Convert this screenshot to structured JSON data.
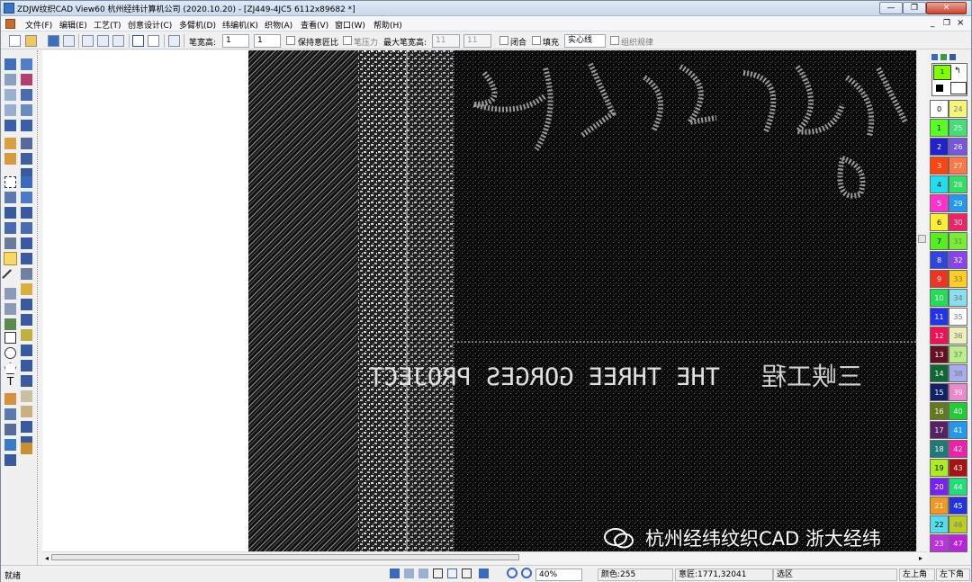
{
  "window": {
    "title": "ZDJW纹织CAD View60 杭州经纬计算机公司 (2020.10.20) - [ZJ449-4JC5 6112x89682 *]",
    "min_label": "—",
    "max_label": "❐",
    "close_label": "✕"
  },
  "menu": {
    "items": [
      "文件(F)",
      "编辑(E)",
      "工艺(T)",
      "创意设计(C)",
      "多臂机(D)",
      "纬编机(K)",
      "织物(A)",
      "查看(V)",
      "窗口(W)",
      "帮助(H)"
    ],
    "mdi_min": "_",
    "mdi_restore": "❐",
    "mdi_close": "×"
  },
  "toolbar": {
    "pen_height_label": "笔宽高:",
    "pen_w_value": "1",
    "pen_h_value": "1",
    "keep_ratio_label": "保持意匠比",
    "pen_pressure_label": "笔压力",
    "max_pen_label": "最大笔宽高:",
    "max_w_value": "11",
    "max_h_value": "11",
    "closed_label": "闭合",
    "fill_label": "填充",
    "line_type_value": "实心线",
    "tissue_rule_label": "组织规律"
  },
  "pattern": {
    "reversed_text": "THE THREE GORGES PROJECT",
    "cjk_fragment": "三峡工程"
  },
  "palette": {
    "current_color": "#7fff00",
    "background_color": "#ffffff",
    "swatches": [
      {
        "left": "0",
        "right": "24",
        "lc": "#ffffff",
        "rc": "#f5f57a"
      },
      {
        "left": "1",
        "right": "25",
        "lc": "#55ff22",
        "rc": "#44dd77"
      },
      {
        "left": "2",
        "right": "26",
        "lc": "#2222cc",
        "rc": "#7755dd"
      },
      {
        "left": "3",
        "right": "27",
        "lc": "#ff4411",
        "rc": "#ff7744"
      },
      {
        "left": "4",
        "right": "28",
        "lc": "#22ddee",
        "rc": "#33dd66"
      },
      {
        "left": "5",
        "right": "29",
        "lc": "#ff33cc",
        "rc": "#2299ee"
      },
      {
        "left": "6",
        "right": "30",
        "lc": "#ffee33",
        "rc": "#ee2266"
      },
      {
        "left": "7",
        "right": "31",
        "lc": "#55ee22",
        "rc": "#77ee33"
      },
      {
        "left": "8",
        "right": "32",
        "lc": "#3344dd",
        "rc": "#8844ee"
      },
      {
        "left": "9",
        "right": "33",
        "lc": "#ee3322",
        "rc": "#ffcc22"
      },
      {
        "left": "10",
        "right": "34",
        "lc": "#22dd55",
        "rc": "#88ddee"
      },
      {
        "left": "11",
        "right": "35",
        "lc": "#2233ee",
        "rc": "#ffffff"
      },
      {
        "left": "12",
        "right": "36",
        "lc": "#ee1155",
        "rc": "#eeeebb"
      },
      {
        "left": "13",
        "right": "37",
        "lc": "#661122",
        "rc": "#bbee88"
      },
      {
        "left": "14",
        "right": "38",
        "lc": "#116633",
        "rc": "#aaaaee"
      },
      {
        "left": "15",
        "right": "39",
        "lc": "#112266",
        "rc": "#ee88cc"
      },
      {
        "left": "16",
        "right": "40",
        "lc": "#667722",
        "rc": "#22cc33"
      },
      {
        "left": "17",
        "right": "41",
        "lc": "#552266",
        "rc": "#2299ee"
      },
      {
        "left": "18",
        "right": "42",
        "lc": "#227777",
        "rc": "#ee22aa"
      },
      {
        "left": "19",
        "right": "43",
        "lc": "#aaee22",
        "rc": "#aa1111"
      },
      {
        "left": "20",
        "right": "44",
        "lc": "#7722ee",
        "rc": "#22dd77"
      },
      {
        "left": "21",
        "right": "45",
        "lc": "#ee9922",
        "rc": "#2233dd"
      },
      {
        "left": "22",
        "right": "46",
        "lc": "#55ddee",
        "rc": "#bbcc22"
      },
      {
        "left": "23",
        "right": "47",
        "lc": "#bb33dd",
        "rc": "#bb22dd"
      }
    ]
  },
  "status": {
    "ready": "就绪",
    "zoom": "40%",
    "color": "颜色:255",
    "coords": "意匠:1771,32041",
    "mode": "选区",
    "top_left": "左上角",
    "bottom_left": "左下角"
  },
  "watermark": {
    "text": "杭州经纬纹织CAD 浙大经纬"
  },
  "icons": [
    "app-icon",
    "new-file-icon",
    "open-folder-icon",
    "save-icon",
    "undo-icon",
    "redo-icon",
    "pencil-icon",
    "zoom-in-icon",
    "zoom-out-icon",
    "wechat-icon"
  ]
}
